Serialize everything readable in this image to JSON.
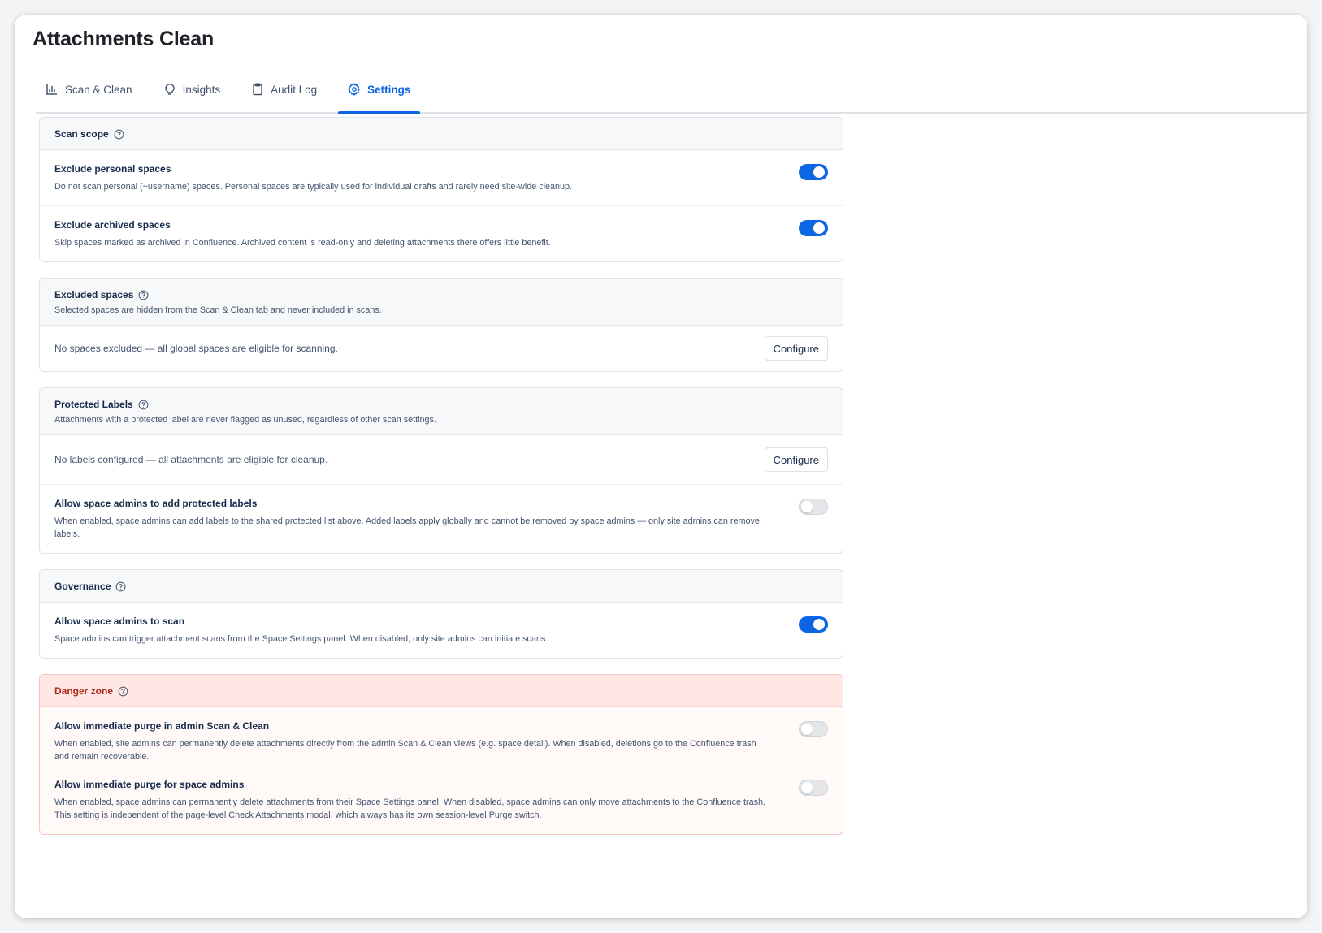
{
  "app": {
    "title": "Attachments Clean"
  },
  "tabs": [
    {
      "label": "Scan & Clean",
      "icon": "bar-chart-icon",
      "active": false
    },
    {
      "label": "Insights",
      "icon": "lightbulb-icon",
      "active": false
    },
    {
      "label": "Audit Log",
      "icon": "clipboard-icon",
      "active": false
    },
    {
      "label": "Settings",
      "icon": "gear-icon",
      "active": true
    }
  ],
  "colors": {
    "accent": "#0c66e4",
    "danger": "#ae2a19",
    "danger_bg": "#ffe7e4"
  },
  "scan_scope": {
    "title": "Scan scope",
    "items": [
      {
        "title": "Exclude personal spaces",
        "desc": "Do not scan personal (~username) spaces. Personal spaces are typically used for individual drafts and rarely need site-wide cleanup.",
        "enabled": true
      },
      {
        "title": "Exclude archived spaces",
        "desc": "Skip spaces marked as archived in Confluence. Archived content is read-only and deleting attachments there offers little benefit.",
        "enabled": true
      }
    ]
  },
  "excluded_spaces": {
    "title": "Excluded spaces",
    "subtitle": "Selected spaces are hidden from the Scan & Clean tab and never included in scans.",
    "status": "No spaces excluded — all global spaces are eligible for scanning.",
    "button": "Configure"
  },
  "protected_labels": {
    "title": "Protected Labels",
    "subtitle": "Attachments with a protected label are never flagged as unused, regardless of other scan settings.",
    "status": "No labels configured — all attachments are eligible for cleanup.",
    "button": "Configure",
    "setting": {
      "title": "Allow space admins to add protected labels",
      "desc": "When enabled, space admins can add labels to the shared protected list above. Added labels apply globally and cannot be removed by space admins — only site admins can remove labels.",
      "enabled": false
    }
  },
  "governance": {
    "title": "Governance",
    "setting": {
      "title": "Allow space admins to scan",
      "desc": "Space admins can trigger attachment scans from the Space Settings panel. When disabled, only site admins can initiate scans.",
      "enabled": true
    }
  },
  "danger_zone": {
    "title": "Danger zone",
    "items": [
      {
        "title": "Allow immediate purge in admin Scan & Clean",
        "desc": "When enabled, site admins can permanently delete attachments directly from the admin Scan & Clean views (e.g. space detail). When disabled, deletions go to the Confluence trash and remain recoverable.",
        "enabled": false
      },
      {
        "title": "Allow immediate purge for space admins",
        "desc": "When enabled, space admins can permanently delete attachments from their Space Settings panel. When disabled, space admins can only move attachments to the Confluence trash. This setting is independent of the page-level Check Attachments modal, which always has its own session-level Purge switch.",
        "enabled": false
      }
    ]
  }
}
